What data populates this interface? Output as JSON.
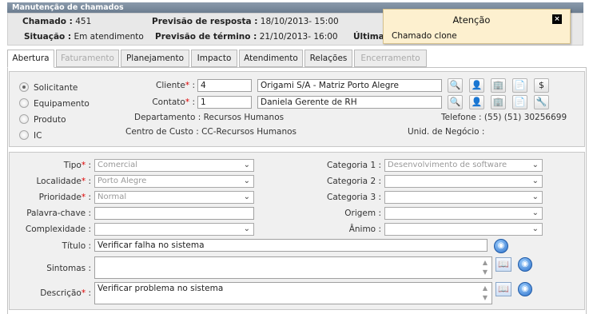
{
  "window_title": "Manutenção de chamados",
  "header": {
    "chamado_label": "Chamado :",
    "chamado_value": "451",
    "prev_resp_label": "Previsão de resposta :",
    "prev_resp_value": "18/10/2013- 15:00",
    "situacao_label": "Situação :",
    "situacao_value": "Em atendimento",
    "prev_term_label": "Previsão de término :",
    "prev_term_value": "21/10/2013- 16:00",
    "ultima_label": "Última"
  },
  "toast": {
    "title": "Atenção",
    "message": "Chamado clone",
    "close": "×"
  },
  "tabs": [
    "Abertura",
    "Faturamento",
    "Planejamento",
    "Impacto",
    "Atendimento",
    "Relações",
    "Encerramento"
  ],
  "radio_options": [
    "Solicitante",
    "Equipamento",
    "Produto",
    "IC"
  ],
  "panel1": {
    "cliente_label": "Cliente",
    "cliente_code": "4",
    "cliente_name": "Origami S/A - Matriz Porto Alegre",
    "contato_label": "Contato",
    "contato_code": "1",
    "contato_name": "Daniela Gerente de RH",
    "departamento": "Departamento : Recursos Humanos",
    "telefone": "Telefone : (55) (51) 30256699",
    "centro_custo": "Centro de Custo : CC-Recursos Humanos",
    "unid_negocio": "Unid. de Negócio :"
  },
  "form": {
    "tipo_label": "Tipo",
    "tipo_value": "Comercial",
    "localidade_label": "Localidade",
    "localidade_value": "Porto Alegre",
    "prioridade_label": "Prioridade",
    "prioridade_value": "Normal",
    "palavra_label": "Palavra-chave :",
    "complexidade_label": "Complexidade :",
    "cat1_label": "Categoria 1 :",
    "cat1_value": "Desenvolvimento de software",
    "cat2_label": "Categoria 2 :",
    "cat3_label": "Categoria 3 :",
    "origem_label": "Origem :",
    "animo_label": "Ânimo :",
    "titulo_label": "Título :",
    "titulo_value": "Verificar falha no sistema",
    "sintomas_label": "Sintomas :",
    "descricao_label": "Descrição",
    "descricao_value": "Verificar problema no sistema"
  },
  "icons": {
    "colors": {
      "accent": "#2a6fc9",
      "required": "#d00000",
      "toast_bg": "#fdf0cf"
    }
  }
}
